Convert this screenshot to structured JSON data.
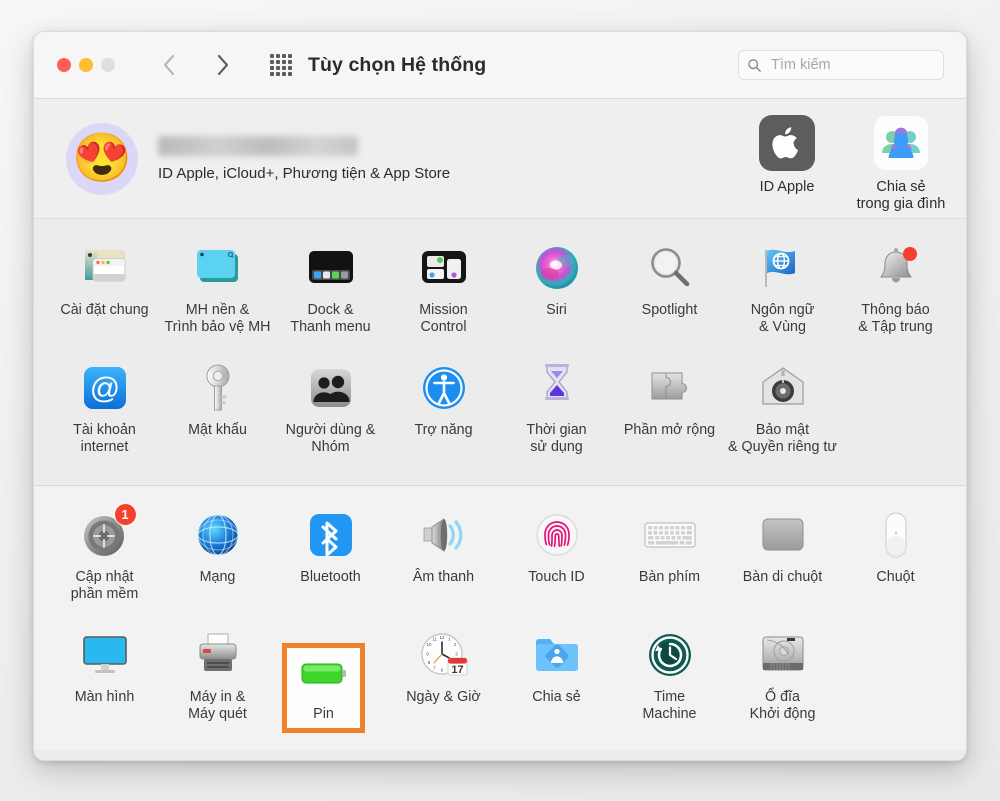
{
  "window": {
    "title": "Tùy chọn Hệ thống",
    "traffic_lights": [
      "close",
      "minimize",
      "zoom"
    ],
    "nav": {
      "back": "back-chevron",
      "forward": "forward-chevron",
      "grid": "show-all-grid"
    },
    "search": {
      "placeholder": "Tìm kiếm",
      "value": "",
      "icon": "search-icon"
    }
  },
  "account": {
    "avatar_emoji": "😍",
    "name": "",
    "subtitle": "ID Apple, iCloud+, Phương tiện & App Store",
    "shortcuts": [
      {
        "label": "ID Apple",
        "icon": "apple-logo-icon"
      },
      {
        "label": "Chia sẻ\ntrong gia đình",
        "icon": "family-sharing-icon"
      }
    ]
  },
  "sections": [
    {
      "id": "section-a",
      "rows": [
        [
          {
            "label": "Cài đặt chung",
            "icon": "general-icon"
          },
          {
            "label": "MH nền &\nTrình bảo vệ MH",
            "icon": "desktop-screensaver-icon"
          },
          {
            "label": "Dock &\nThanh menu",
            "icon": "dock-menubar-icon"
          },
          {
            "label": "Mission\nControl",
            "icon": "mission-control-icon"
          },
          {
            "label": "Siri",
            "icon": "siri-icon"
          },
          {
            "label": "Spotlight",
            "icon": "spotlight-icon"
          },
          {
            "label": "Ngôn ngữ\n& Vùng",
            "icon": "language-region-icon"
          },
          {
            "label": "Thông báo\n& Tập trung",
            "icon": "notifications-focus-icon",
            "badge": ""
          }
        ],
        [
          {
            "label": "Tài khoản\ninternet",
            "icon": "internet-accounts-icon"
          },
          {
            "label": "Mật khẩu",
            "icon": "passwords-key-icon"
          },
          {
            "label": "Người dùng &\nNhóm",
            "icon": "users-groups-icon"
          },
          {
            "label": "Trợ năng",
            "icon": "accessibility-icon"
          },
          {
            "label": "Thời gian\nsử dụng",
            "icon": "screen-time-icon"
          },
          {
            "label": "Phần mở rộng",
            "icon": "extensions-puzzle-icon"
          },
          {
            "label": "Bảo mật\n& Quyền riêng tư",
            "icon": "security-privacy-icon"
          },
          {
            "label": "",
            "icon": "",
            "empty": true
          }
        ]
      ]
    },
    {
      "id": "section-b",
      "rows": [
        [
          {
            "label": "Cập nhật\nphần mềm",
            "icon": "software-update-icon",
            "badge": "1"
          },
          {
            "label": "Mạng",
            "icon": "network-globe-icon"
          },
          {
            "label": "Bluetooth",
            "icon": "bluetooth-icon"
          },
          {
            "label": "Âm thanh",
            "icon": "sound-speaker-icon"
          },
          {
            "label": "Touch ID",
            "icon": "touch-id-icon"
          },
          {
            "label": "Bàn phím",
            "icon": "keyboard-icon"
          },
          {
            "label": "Bàn di chuột",
            "icon": "trackpad-icon"
          },
          {
            "label": "Chuột",
            "icon": "mouse-icon"
          }
        ],
        [
          {
            "label": "Màn hình",
            "icon": "displays-icon"
          },
          {
            "label": "Máy in &\nMáy quét",
            "icon": "printers-scanners-icon"
          },
          {
            "label": "Pin",
            "icon": "battery-icon",
            "highlighted": true
          },
          {
            "label": "Ngày & Giờ",
            "icon": "date-time-icon",
            "day": "17"
          },
          {
            "label": "Chia sẻ",
            "icon": "sharing-folder-icon"
          },
          {
            "label": "Time\nMachine",
            "icon": "time-machine-icon"
          },
          {
            "label": "Ổ đĩa\nKhởi động",
            "icon": "startup-disk-icon"
          },
          {
            "label": "",
            "icon": "",
            "empty": true
          }
        ]
      ]
    }
  ],
  "annotation": {
    "target": "Pin",
    "color": "#f0802a",
    "shape": "rectangle"
  },
  "colors": {
    "window_bg": "#ececec",
    "titlebar_bg": "#f6f6f6",
    "accent_orange": "#f0802a",
    "badge_red": "#f73f2e",
    "label_text": "#3a3a3a"
  }
}
